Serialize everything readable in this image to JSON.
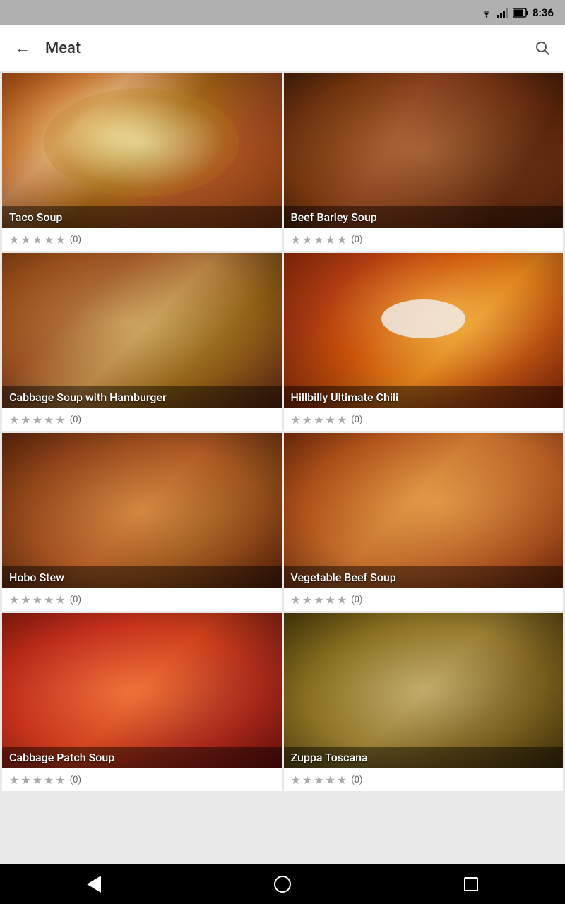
{
  "statusBar": {
    "time": "8:36",
    "icons": [
      "wifi",
      "signal",
      "battery"
    ]
  },
  "appBar": {
    "title": "Meat",
    "backLabel": "←",
    "searchLabel": "🔍"
  },
  "recipes": [
    {
      "id": "taco-soup",
      "name": "Taco Soup",
      "imageClass": "img-taco-soup",
      "rating": 0,
      "ratingCount": "(0)"
    },
    {
      "id": "beef-barley-soup",
      "name": "Beef Barley Soup",
      "imageClass": "img-beef-barley",
      "rating": 0,
      "ratingCount": "(0)"
    },
    {
      "id": "cabbage-soup-hamburger",
      "name": "Cabbage Soup with Hamburger",
      "imageClass": "img-cabbage-hamburger",
      "rating": 0,
      "ratingCount": "(0)"
    },
    {
      "id": "hillbilly-ultimate-chili",
      "name": "Hillbilly Ultimate Chili",
      "imageClass": "img-hillbilly-chili",
      "rating": 0,
      "ratingCount": "(0)"
    },
    {
      "id": "hobo-stew",
      "name": "Hobo Stew",
      "imageClass": "img-hobo-stew",
      "rating": 0,
      "ratingCount": "(0)"
    },
    {
      "id": "vegetable-beef-soup",
      "name": "Vegetable Beef Soup",
      "imageClass": "img-vegetable-beef",
      "rating": 0,
      "ratingCount": "(0)"
    },
    {
      "id": "cabbage-patch-soup",
      "name": "Cabbage Patch Soup",
      "imageClass": "img-cabbage-patch",
      "rating": 0,
      "ratingCount": "(0)"
    },
    {
      "id": "zuppa-toscana",
      "name": "Zuppa Toscana",
      "imageClass": "img-zuppa-toscana",
      "rating": 0,
      "ratingCount": "(0)"
    }
  ],
  "nav": {
    "back": "back",
    "home": "home",
    "recent": "recent"
  }
}
